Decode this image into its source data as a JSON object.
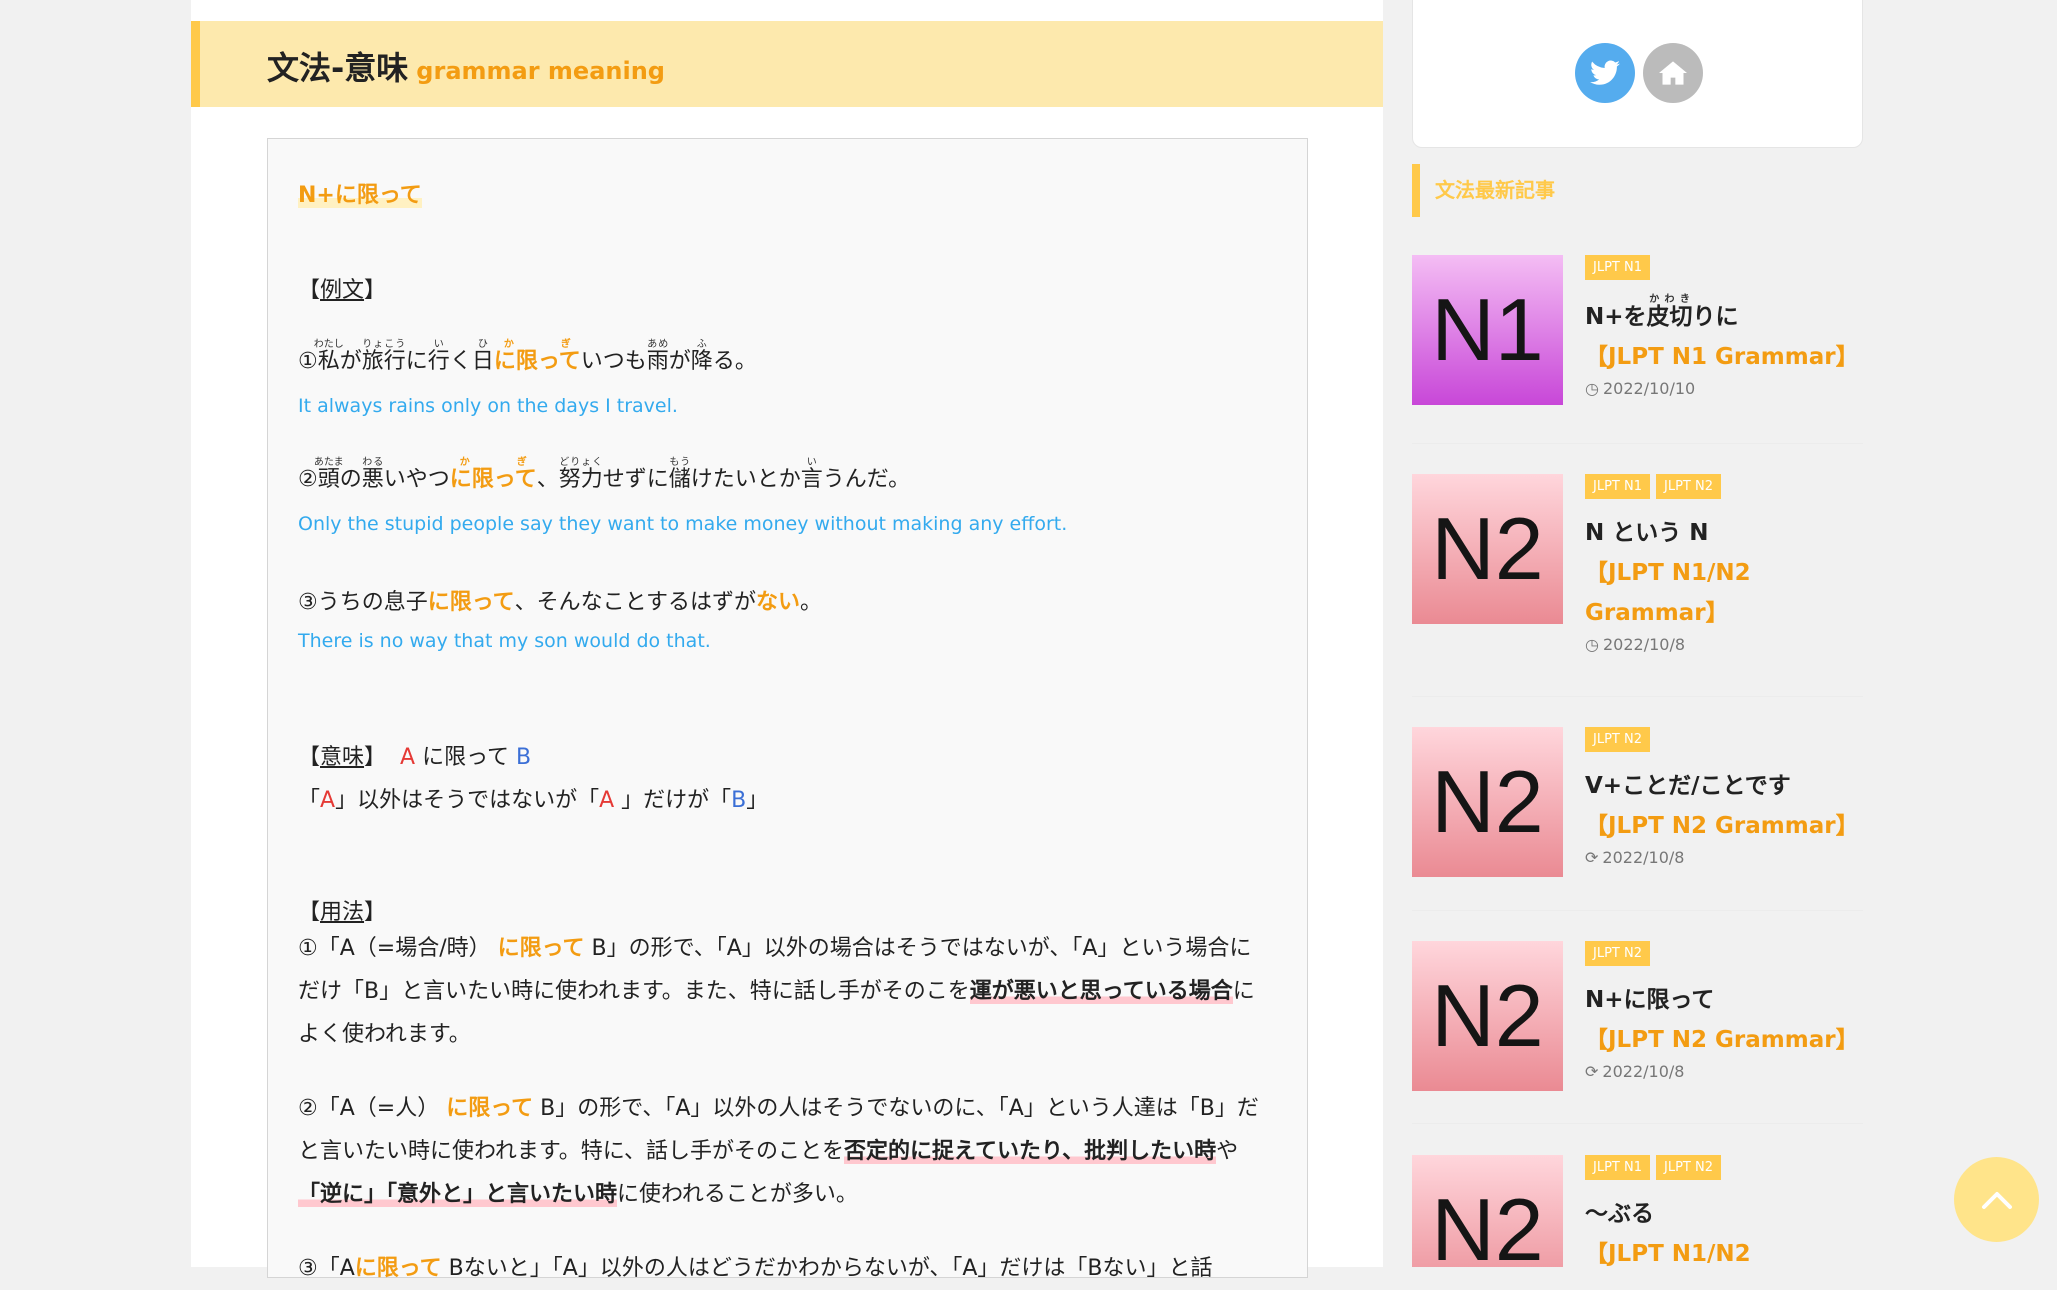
{
  "section": {
    "title_jp": "文法-意味",
    "title_en": "grammar meaning"
  },
  "content": {
    "pattern": "N+に限って",
    "example_heading_l": "【",
    "example_heading": "例文",
    "example_heading_r": "】",
    "ex1": {
      "num": "①",
      "watashi": "私",
      "watashi_r": "わたし",
      "ga": "が",
      "ryokou": "旅行",
      "ryokou_r": "りょこう",
      "ni": "に",
      "iku": "行",
      "iku_r": "い",
      "ku": "く",
      "hi": "日",
      "hi_r": "ひ",
      "gram": "に限って",
      "gram_r": "かぎ",
      "itsumo": "いつも",
      "ame": "雨",
      "ame_r": "あめ",
      "ga2": "が",
      "furu": "降",
      "furu_r": "ふ",
      "ru": "る。",
      "en": "It always rains only on the days I travel."
    },
    "ex2": {
      "num": "②",
      "atama": "頭",
      "atama_r": "あたま",
      "no": "の",
      "waru": "悪",
      "waru_r": "わる",
      "iyatsu": "いやつ",
      "gram": "に限って",
      "gram_r": "かぎ",
      "comma": "、",
      "doryoku": "努力",
      "doryoku_r": "どりょく",
      "sezuni": "せずに",
      "mou": "儲",
      "mou_r": "もう",
      "ketai": "けたいとか",
      "i": "言",
      "i_r": "い",
      "unda": "うんだ。",
      "en": "Only the stupid people say they want to make money without making any effort."
    },
    "ex3": {
      "pre": "③うちの息子",
      "gram": "に限って",
      "mid": "、そんなことするはずが",
      "nai": "ない",
      "end": "。",
      "en": "There is no way that my son would do that."
    },
    "meaning": {
      "heading_l": "【",
      "heading": "意味",
      "heading_r": "】",
      "A": "A",
      "mid": "に限って",
      "B": "B",
      "line2_1": "「",
      "line2_A": "A",
      "line2_2": "」以外はそうではないが「",
      "line2_A2": "A",
      "line2_3": " 」だけが「",
      "line2_B": "B",
      "line2_4": "」"
    },
    "usage": {
      "heading_l": "【",
      "heading": "用法",
      "heading_r": "】",
      "p1_a": "①「A（=場合/時）",
      "p1_gram": "に限って",
      "p1_b": " B」の形で、「A」以外の場合はそうではないが、「A」という場合にだけ「B」と言いたい時に使われます。また、特に話し手がそのこを",
      "p1_bold": "運が悪いと思っている場合",
      "p1_c": "によく使われます。",
      "p2_a": "②「A（=人）",
      "p2_gram": "に限って",
      "p2_b": " B」の形で、「A」以外の人はそうでないのに、「A」という人達は「B」だと言いたい時に使われます。特に、話し手がそのことを",
      "p2_bold1": "否定的に捉えていたり、批判したい時",
      "p2_c": "や",
      "p2_bold2": "「逆に」「意外と」と言いたい時",
      "p2_d": "に使われることが多い。",
      "p3_a": "③「A",
      "p3_gram": "に限って",
      "p3_b": " Bないと」「A」以外の人はどうだかわからないが、「A」だけは「Bない」と話"
    }
  },
  "sidebar": {
    "heading": "文法最新記事",
    "articles": [
      {
        "thumb": "N1",
        "tags": [
          "JLPT N1"
        ],
        "title_a": "N+を",
        "title_ruby": "皮切",
        "title_ruby_r": "かわき",
        "title_b": "りに",
        "sub": "【JLPT N1 Grammar】",
        "date": "2022/10/10"
      },
      {
        "thumb": "N2",
        "tags": [
          "JLPT N1",
          "JLPT N2"
        ],
        "title": "N という N",
        "sub": "【JLPT N1/N2 Grammar】",
        "date": "2022/10/8"
      },
      {
        "thumb": "N2",
        "tags": [
          "JLPT N2"
        ],
        "title": "V+ことだ/ことです",
        "sub": "【JLPT N2 Grammar】",
        "date": "2022/10/8"
      },
      {
        "thumb": "N2",
        "tags": [
          "JLPT N2"
        ],
        "title": "N+に限って",
        "sub": "【JLPT N2 Grammar】",
        "date": "2022/10/8"
      },
      {
        "thumb": "N2",
        "tags": [
          "JLPT N1",
          "JLPT N2"
        ],
        "title": "〜ぶる",
        "sub": "【JLPT N1/N2"
      }
    ]
  },
  "colors": {
    "accent": "#ffc94a",
    "orange": "#f39c12",
    "english": "#33aaee",
    "twitter": "#55acee"
  }
}
